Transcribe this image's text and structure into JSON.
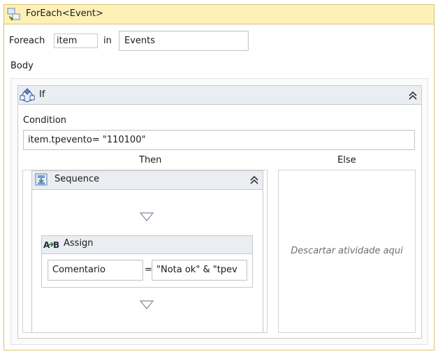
{
  "foreach": {
    "title": "ForEach<Event>",
    "foreach_label": "Foreach",
    "item_value": "item",
    "in_label": "in",
    "collection_value": "Events",
    "body_label": "Body"
  },
  "if_activity": {
    "title": "If",
    "condition_label": "Condition",
    "condition_value": "item.tpevento= \"110100\"",
    "then_label": "Then",
    "else_label": "Else",
    "else_placeholder": "Descartar atividade aqui"
  },
  "sequence": {
    "title": "Sequence"
  },
  "assign": {
    "icon_text": "A→B",
    "title": "Assign",
    "to_value": "Comentario",
    "operator": "=",
    "value_value": "\"Nota ok\" & \"tpev"
  },
  "colors": {
    "foreach_header": "#fdf1b8",
    "foreach_border": "#d9c37a",
    "activity_header": "#eaedf1",
    "border": "#c9c9c9"
  },
  "icons": [
    "foreach-icon",
    "if-icon",
    "sequence-icon",
    "assign-icon",
    "collapse-icon",
    "drop-target-icon"
  ]
}
